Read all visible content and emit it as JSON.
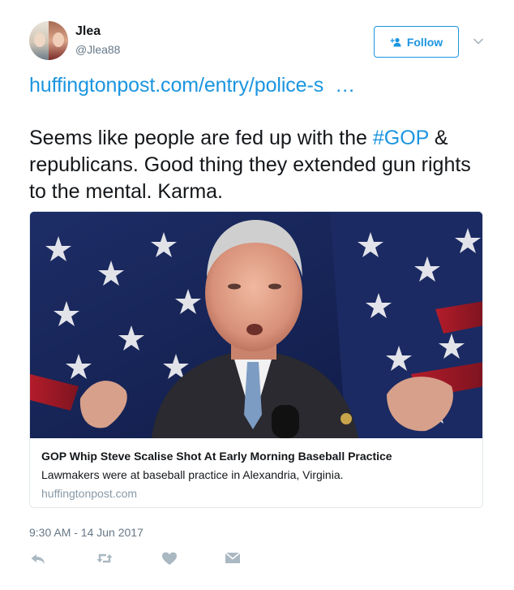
{
  "user": {
    "name": "Jlea",
    "handle": "@Jlea88"
  },
  "follow_button": {
    "label": "Follow"
  },
  "tweet": {
    "link_text": "huffingtonpost.com/entry/police-s",
    "link_ellipsis": "…",
    "text_before": "Seems like people are fed up with the ",
    "hashtag": "#GOP",
    "text_after": " & republicans. Good thing they extended gun rights to the mental. Karma."
  },
  "card": {
    "title": "GOP Whip Steve Scalise Shot At Early Morning Baseball Practice",
    "description": "Lawmakers were at baseball practice in Alexandria, Virginia.",
    "domain": "huffingtonpost.com"
  },
  "timestamp": "9:30 AM - 14 Jun 2017",
  "actions": {
    "icons": [
      "reply-icon",
      "retweet-icon",
      "like-icon",
      "direct-message-icon"
    ]
  },
  "colors": {
    "accent": "#1b95e0",
    "text": "#14171a",
    "muted": "#657786",
    "icon": "#aab8c2",
    "border": "#e1e8ed"
  }
}
